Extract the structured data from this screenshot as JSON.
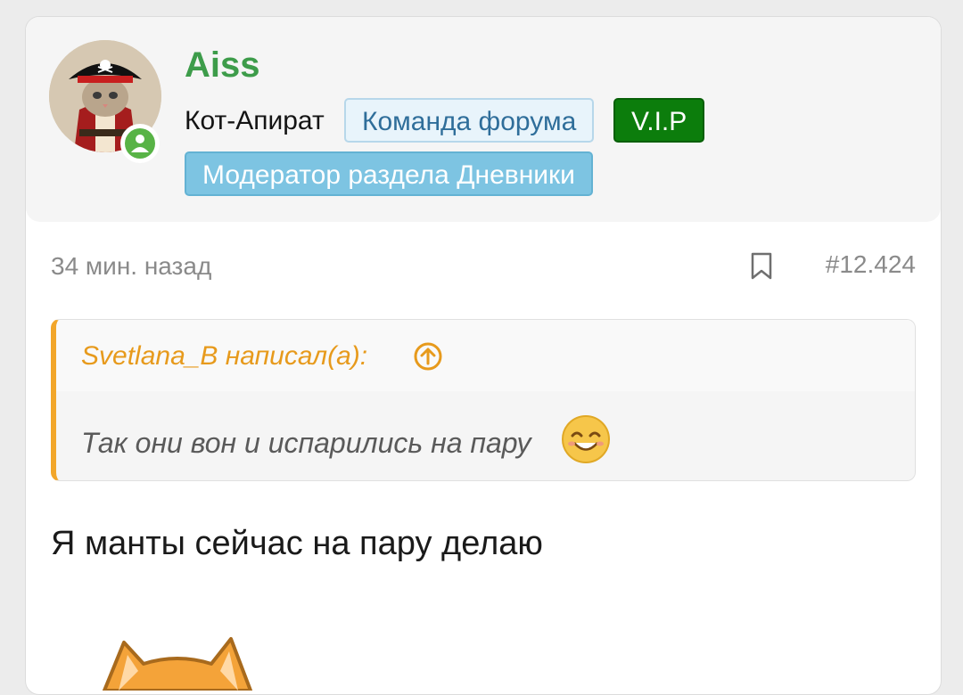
{
  "post": {
    "user": {
      "name": "Aiss",
      "title": "Кот-Апират",
      "badges": {
        "team": "Команда форума",
        "vip": "V.I.P",
        "moderator": "Модератор раздела Дневники"
      },
      "status_color": "#58b346"
    },
    "time": "34 мин. назад",
    "number": "#12.424",
    "quote": {
      "author_line": "Svetlana_B написал(а):",
      "text": "Так они вон и испарились на пару"
    },
    "message": "Я манты сейчас на пару делаю"
  },
  "icons": {
    "bookmark": "bookmark-icon",
    "quote_jump": "arrow-up-circle-icon",
    "emoji": "smiling-face-icon",
    "sticker": "cat-sticker"
  },
  "colors": {
    "username": "#3d9c4a",
    "quote_accent": "#f2a62a",
    "vip": "#0c7d0c",
    "moderator_badge": "#7dc4e2"
  }
}
